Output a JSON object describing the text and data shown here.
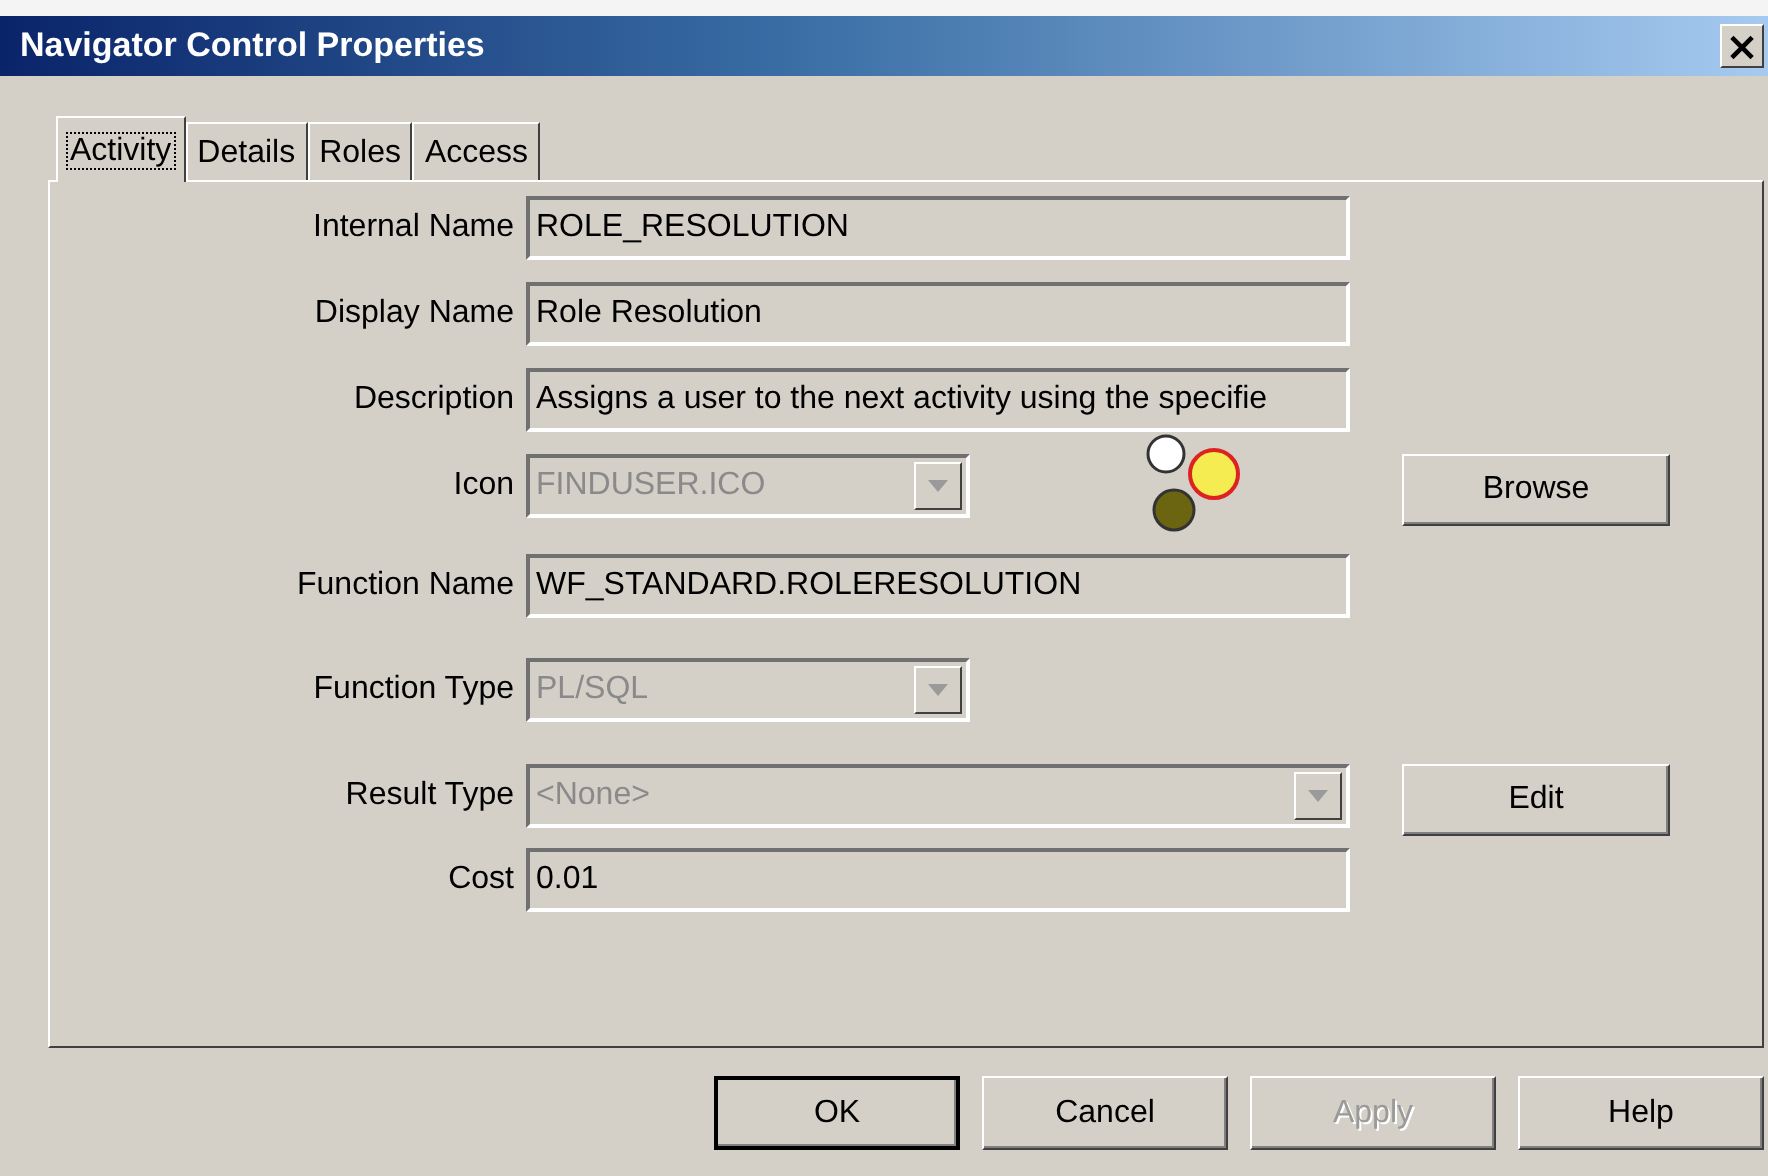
{
  "window": {
    "title": "Navigator Control Properties",
    "close": "×"
  },
  "tabs": [
    {
      "label": "Activity",
      "selected": true
    },
    {
      "label": "Details",
      "selected": false
    },
    {
      "label": "Roles",
      "selected": false
    },
    {
      "label": "Access",
      "selected": false
    }
  ],
  "fields": [
    {
      "kind": "text",
      "label": "Internal Name",
      "value": "ROLE_RESOLUTION"
    },
    {
      "kind": "text",
      "label": "Display Name",
      "value": "Role Resolution"
    },
    {
      "kind": "text",
      "label": "Description",
      "value": "Assigns a user to the next activity using the specifie"
    },
    {
      "kind": "combo",
      "label": "Icon",
      "value": "FINDUSER.ICO",
      "disabled": true,
      "preview": true,
      "button": "Browse"
    },
    {
      "kind": "text",
      "label": "Function Name",
      "value": "WF_STANDARD.ROLERESOLUTION"
    },
    {
      "kind": "combo",
      "label": "Function Type",
      "value": "PL/SQL",
      "disabled": true
    },
    {
      "kind": "longcombo",
      "label": "Result Type",
      "value": "<None>",
      "disabled": true,
      "button": "Edit"
    },
    {
      "kind": "text",
      "label": "Cost",
      "value": "0.01"
    }
  ],
  "buttons": [
    {
      "label": "OK",
      "default": true,
      "disabled": false
    },
    {
      "label": "Cancel",
      "default": false,
      "disabled": false
    },
    {
      "label": "Apply",
      "default": false,
      "disabled": true
    },
    {
      "label": "Help",
      "default": false,
      "disabled": false
    }
  ]
}
